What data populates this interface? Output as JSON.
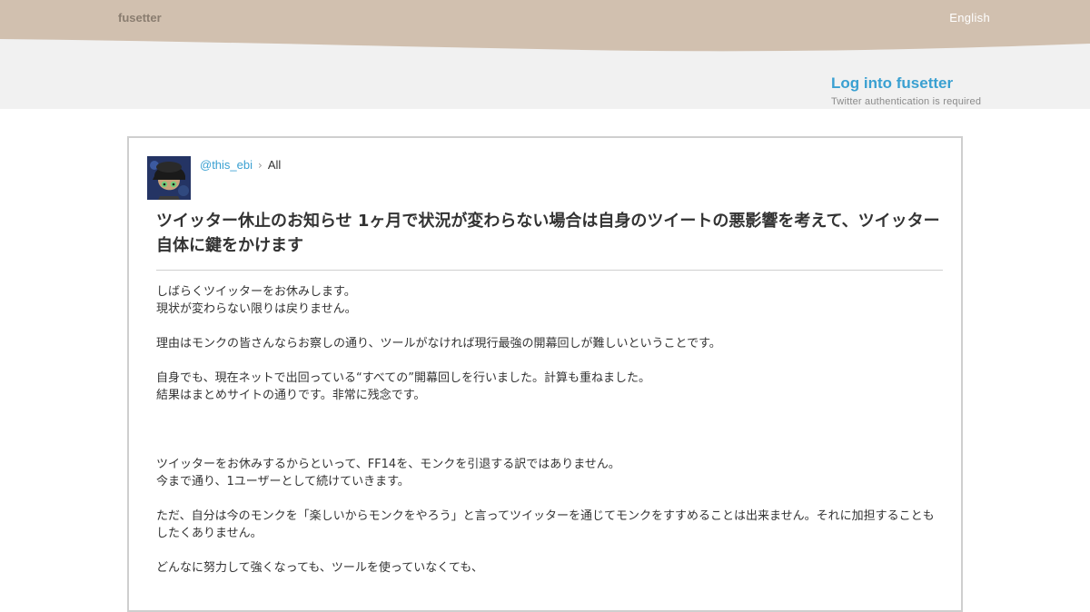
{
  "header": {
    "brand": "fusetter",
    "language": "English",
    "band_color": "#d1c0af"
  },
  "login": {
    "link_label": "Log into fusetter",
    "note": "Twitter authentication is required",
    "link_color": "#3aa0d1"
  },
  "post": {
    "author": "@this_ebi",
    "separator": "›",
    "category": "All",
    "title": "ツイッター休止のお知らせ 1ヶ月で状況が変わらない場合は自身のツイートの悪影響を考えて、ツイッター自体に鍵をかけます",
    "lines": [
      "しばらくツイッターをお休みします。",
      "現状が変わらない限りは戻りません。",
      "",
      "理由はモンクの皆さんならお察しの通り、ツールがなければ現行最強の開幕回しが難しいということです。",
      "",
      "自身でも、現在ネットで出回っている“すべての”開幕回しを行いました。計算も重ねました。",
      "結果はまとめサイトの通りです。非常に残念です。",
      "",
      "",
      "",
      "ツイッターをお休みするからといって、FF14を、モンクを引退する訳ではありません。",
      "今まで通り、1ユーザーとして続けていきます。",
      "",
      "ただ、自分は今のモンクを「楽しいからモンクをやろう」と言ってツイッターを通じてモンクをすすめることは出来ません。それに加担することもしたくありません。",
      "",
      "どんなに努力して強くなっても、ツールを使っていなくても、"
    ]
  }
}
